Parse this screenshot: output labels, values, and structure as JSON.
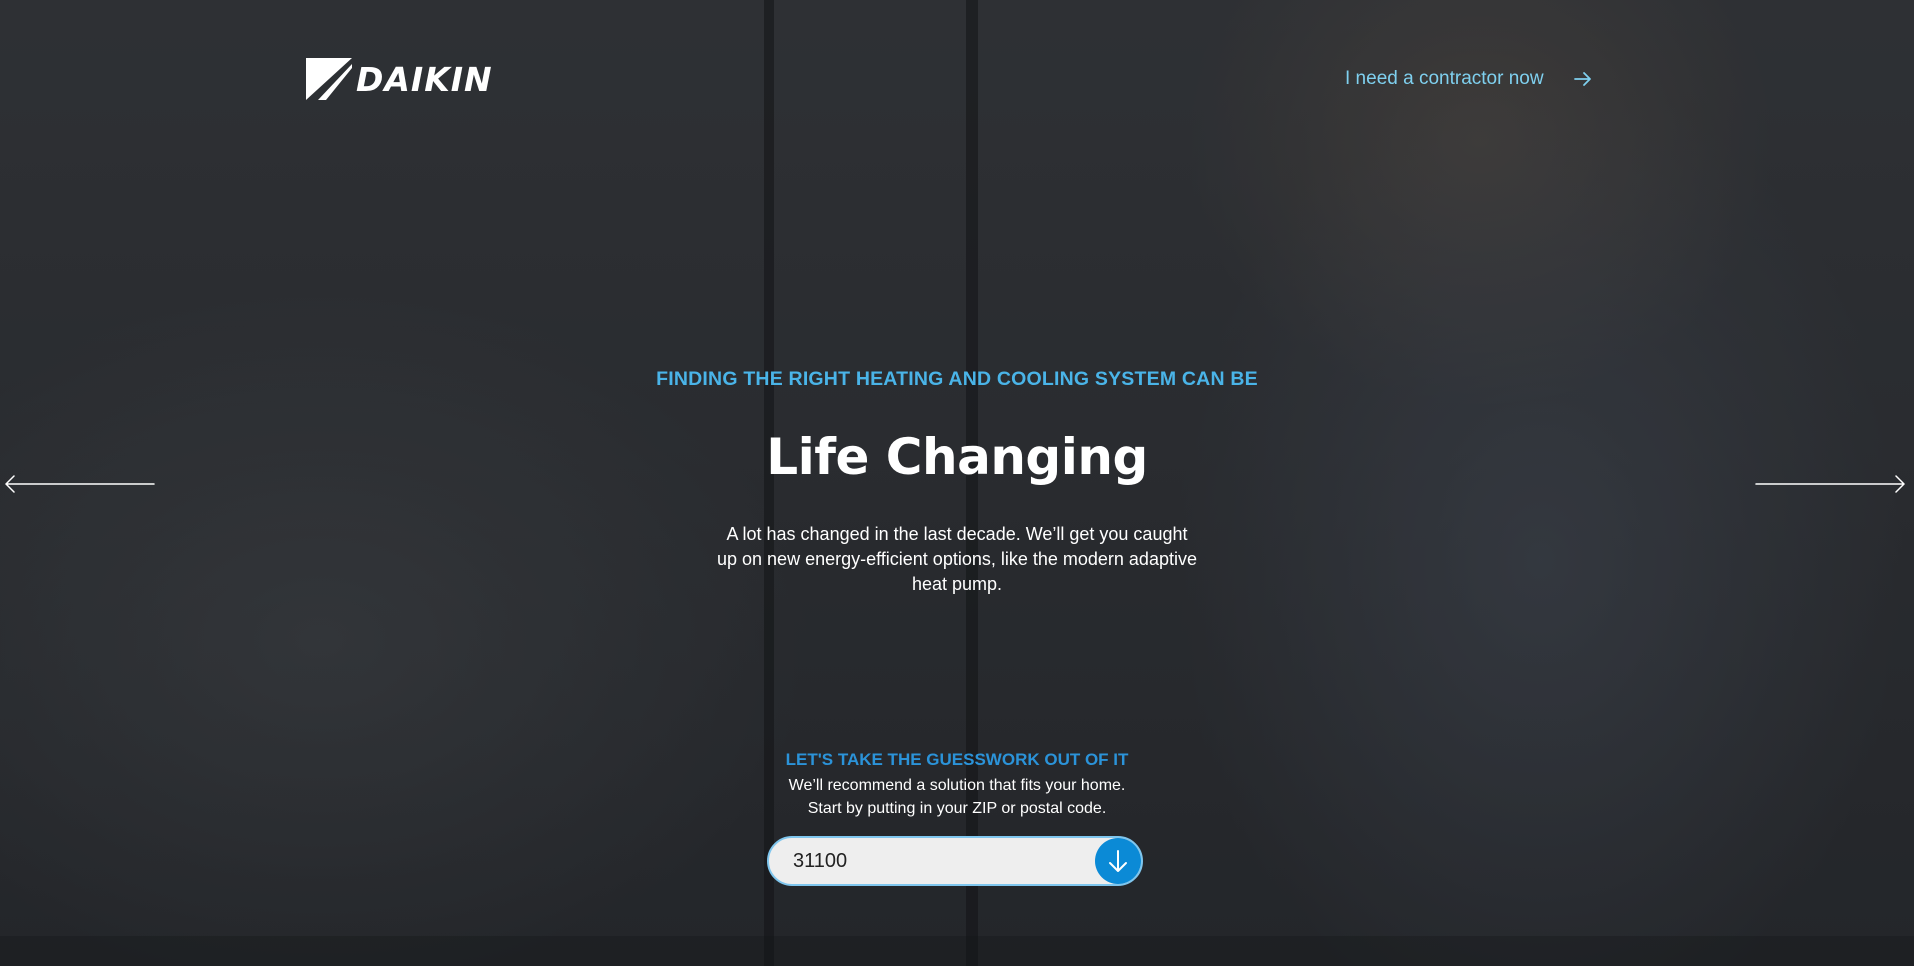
{
  "header": {
    "logo_text": "DAIKIN",
    "contractor_link_label": "I need a contractor now"
  },
  "hero": {
    "eyebrow": "FINDING THE RIGHT HEATING AND COOLING SYSTEM CAN BE",
    "headline": "Life Changing",
    "intro": "A lot has changed in the last decade. We’ll get you caught up on new energy-efficient options, like the modern adaptive heat pump."
  },
  "cta": {
    "title": "LET'S TAKE THE GUESSWORK OUT OF IT",
    "line1": "We’ll recommend a solution that fits your home.",
    "line2": "Start by putting in your ZIP or postal code.",
    "zip_value": "31100"
  },
  "icons": {
    "contractor_arrow": "arrow-right-icon",
    "prev_slide": "long-arrow-left-icon",
    "next_slide": "long-arrow-right-icon",
    "zip_submit": "arrow-down-icon"
  },
  "colors": {
    "accent_light": "#7fd0ef",
    "accent": "#4ab4e8",
    "button": "#0b8ad6",
    "cta_title": "#2b93d9"
  }
}
